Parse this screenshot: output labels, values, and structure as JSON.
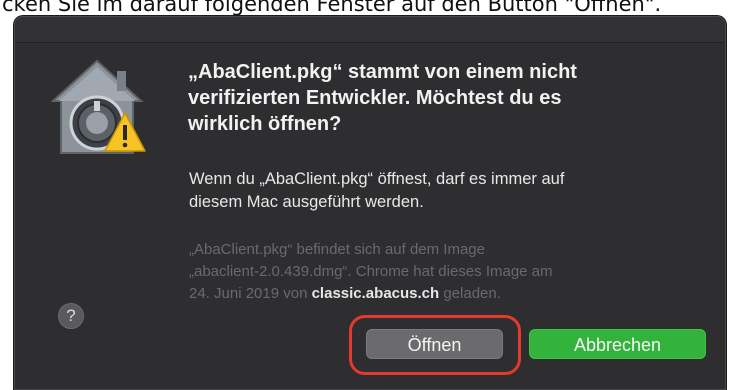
{
  "caption": {
    "text": "cken Sie im darauf folgenden Fenster auf den Button \"Öffnen\"."
  },
  "dialog": {
    "icon": "gatekeeper-warning-icon",
    "heading_lines": [
      "„AbaClient.pkg“ stammt von einem nicht",
      "verifizierten Entwickler. Möchtest du es",
      "wirklich öffnen?"
    ],
    "body_lines": [
      "Wenn du „AbaClient.pkg“ öffnest, darf es immer auf",
      "diesem Mac ausgeführt werden."
    ],
    "info": {
      "line1": "„AbaClient.pkg“ befindet sich auf dem Image",
      "line2": "„abaclient-2.0.439.dmg“. Chrome hat dieses Image am",
      "line3_before": "24. Juni 2019 von ",
      "line3_bold": "classic.abacus.ch",
      "line3_after": " geladen."
    },
    "help_label": "?",
    "open_button_label": "Öffnen",
    "cancel_button_label": "Abbrechen",
    "colors": {
      "background": "#2e2e30",
      "cancel_button": "#33b33c",
      "highlight_ring": "#e23a2e"
    }
  }
}
